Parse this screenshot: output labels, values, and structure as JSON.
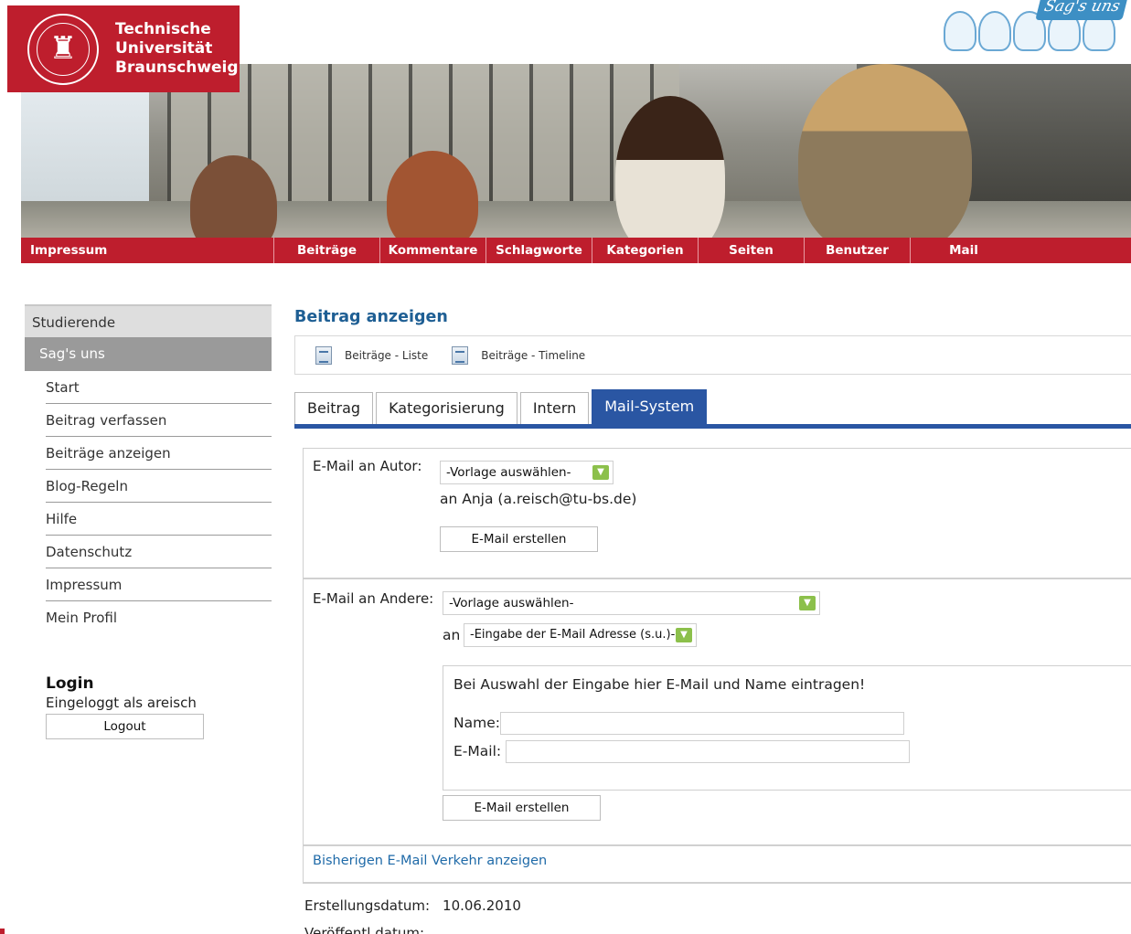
{
  "header": {
    "university": [
      "Technische",
      "Universität",
      "Braunschweig"
    ],
    "badge": "Sag's uns"
  },
  "nav": [
    "Impressum",
    "Beiträge",
    "Kommentare",
    "Schlagworte",
    "Kategorien",
    "Seiten",
    "Benutzer",
    "Mail"
  ],
  "sidebar": {
    "section": "Studierende",
    "active": "Sag's uns",
    "items": [
      "Start",
      "Beitrag verfassen",
      "Beiträge anzeigen",
      "Blog-Regeln",
      "Hilfe",
      "Datenschutz",
      "Impressum",
      "Mein Profil"
    ]
  },
  "login": {
    "title": "Login",
    "status": "Eingeloggt als areisch",
    "logout": "Logout"
  },
  "main": {
    "title": "Beitrag anzeigen",
    "toolbar": [
      "Beiträge - Liste",
      "Beiträge - Timeline"
    ],
    "tabs": [
      "Beitrag",
      "Kategorisierung",
      "Intern",
      "Mail-System"
    ],
    "author_mail": {
      "label": "E-Mail an Autor:",
      "template": "-Vorlage auswählen-",
      "recipient": "an Anja (a.reisch@tu-bs.de)",
      "button": "E-Mail erstellen"
    },
    "other_mail": {
      "label": "E-Mail an Andere:",
      "template": "-Vorlage auswählen-",
      "an": "an",
      "recipient_select": "-Eingabe der E-Mail Adresse (s.u.)-",
      "hint": "Bei Auswahl der Eingabe hier E-Mail und Name eintragen!",
      "name_label": "Name:",
      "email_label": "E-Mail:",
      "name_value": "",
      "email_value": "",
      "button": "E-Mail erstellen"
    },
    "history_link": "Bisherigen E-Mail Verkehr anzeigen",
    "meta": {
      "created_label": "Erstellungsdatum:",
      "created_value": "10.06.2010",
      "published_label": "Veröffentl.datum:"
    }
  },
  "colors": {
    "brand_red": "#be1e2d",
    "tab_blue": "#2a56a3",
    "link_blue": "#1f6aa8",
    "select_green": "#8cc04b"
  }
}
